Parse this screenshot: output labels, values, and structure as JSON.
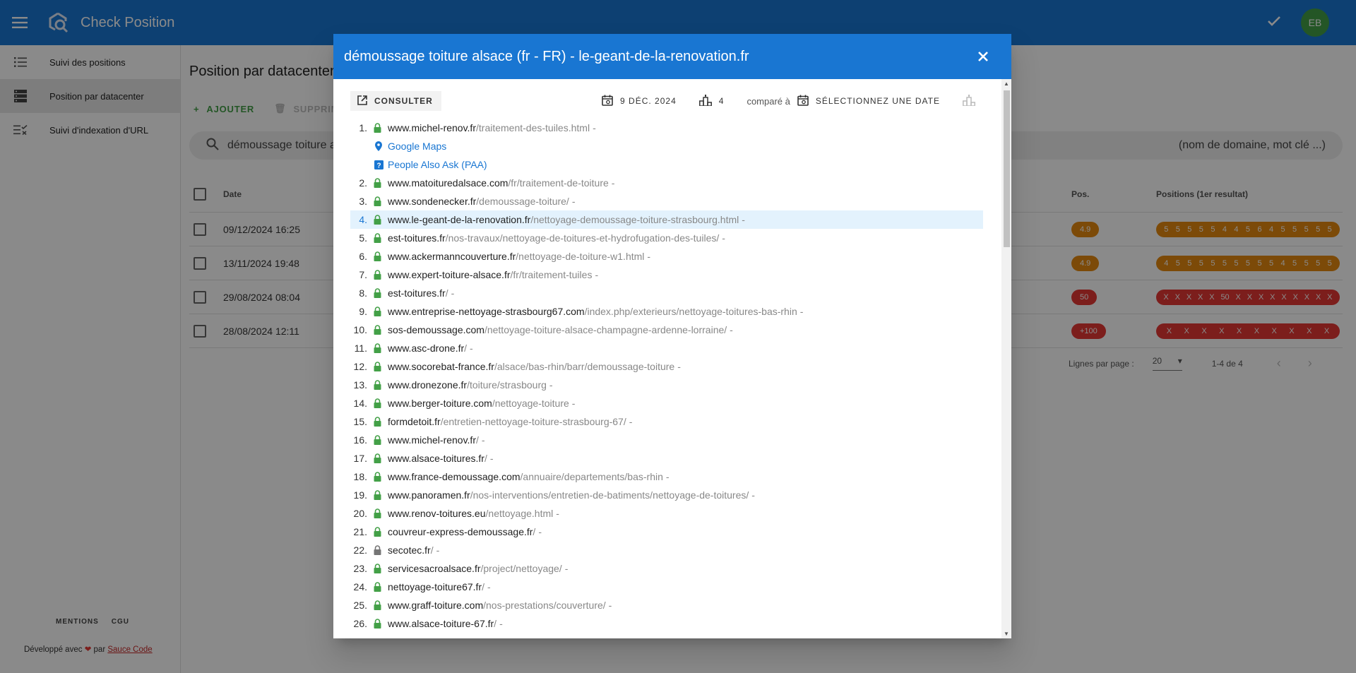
{
  "app": {
    "title": "Check Position",
    "avatar_initials": "EB"
  },
  "sidebar": {
    "items": [
      {
        "label": "Suivi des positions"
      },
      {
        "label": "Position par datacenter"
      },
      {
        "label": "Suivi d'indexation d'URL"
      }
    ],
    "footer_links": [
      "MENTIONS",
      "CGU"
    ],
    "dev_prefix": "Développé avec",
    "dev_mid": "par",
    "dev_link": "Sauce Code"
  },
  "main": {
    "title": "Position par datacenter",
    "add_label": "AJOUTER",
    "delete_label": "SUPPRIMER",
    "search_value": "démoussage toiture alsace",
    "search_placeholder": "(nom de domaine, mot clé ...)",
    "columns": {
      "date": "Date",
      "pos": "Pos.",
      "positions": "Positions (1er resultat)"
    },
    "rows": [
      {
        "date": "09/12/2024 16:25",
        "pos": "4.9",
        "positions": [
          "5",
          "5",
          "5",
          "5",
          "5",
          "4",
          "4",
          "5",
          "6",
          "4",
          "5",
          "5",
          "5",
          "5",
          "5"
        ]
      },
      {
        "date": "13/11/2024 19:48",
        "pos": "4.9",
        "positions": [
          "4",
          "5",
          "5",
          "5",
          "5",
          "5",
          "5",
          "5",
          "5",
          "5",
          "4",
          "5",
          "5",
          "5",
          "5"
        ]
      },
      {
        "date": "29/08/2024 08:04",
        "pos": "50",
        "positions": [
          "X",
          "X",
          "X",
          "X",
          "X",
          "50",
          "X",
          "X",
          "X",
          "X",
          "X",
          "X",
          "X",
          "X",
          "X"
        ]
      },
      {
        "date": "28/08/2024 12:11",
        "pos": "+100",
        "positions": [
          "X",
          "X",
          "X",
          "X",
          "X",
          "X",
          "X",
          "X",
          "X",
          "X"
        ]
      }
    ],
    "pagination": {
      "rows_label": "Lignes par page :",
      "rows_value": "20",
      "range": "1-4 de 4"
    }
  },
  "dialog": {
    "title": "démoussage toiture alsace (fr - FR) - le-geant-de-la-renovation.fr",
    "consult_label": "CONSULTER",
    "date_label": "9 DÉC. 2024",
    "position_value": "4",
    "compare_label": "comparé à",
    "select_date_label": "SÉLECTIONNEZ UNE DATE",
    "features": [
      "Google Maps",
      "People Also Ask (PAA)"
    ],
    "results": [
      {
        "n": "1.",
        "domain": "www.michel-renov.fr",
        "path": "/traitement-des-tuiles.html"
      },
      {
        "n": "2.",
        "domain": "www.matoituredalsace.com",
        "path": "/fr/traitement-de-toiture"
      },
      {
        "n": "3.",
        "domain": "www.sondenecker.fr",
        "path": "/demoussage-toiture/"
      },
      {
        "n": "4.",
        "domain": "www.le-geant-de-la-renovation.fr",
        "path": "/nettoyage-demoussage-toiture-strasbourg.html"
      },
      {
        "n": "5.",
        "domain": "est-toitures.fr",
        "path": "/nos-travaux/nettoyage-de-toitures-et-hydrofugation-des-tuiles/"
      },
      {
        "n": "6.",
        "domain": "www.ackermanncouverture.fr",
        "path": "/nettoyage-de-toiture-w1.html"
      },
      {
        "n": "7.",
        "domain": "www.expert-toiture-alsace.fr",
        "path": "/fr/traitement-tuiles"
      },
      {
        "n": "8.",
        "domain": "est-toitures.fr",
        "path": "/"
      },
      {
        "n": "9.",
        "domain": "www.entreprise-nettoyage-strasbourg67.com",
        "path": "/index.php/exterieurs/nettoyage-toitures-bas-rhin"
      },
      {
        "n": "10.",
        "domain": "sos-demoussage.com",
        "path": "/nettoyage-toiture-alsace-champagne-ardenne-lorraine/"
      },
      {
        "n": "11.",
        "domain": "www.asc-drone.fr",
        "path": "/"
      },
      {
        "n": "12.",
        "domain": "www.socorebat-france.fr",
        "path": "/alsace/bas-rhin/barr/demoussage-toiture"
      },
      {
        "n": "13.",
        "domain": "www.dronezone.fr",
        "path": "/toiture/strasbourg"
      },
      {
        "n": "14.",
        "domain": "www.berger-toiture.com",
        "path": "/nettoyage-toiture"
      },
      {
        "n": "15.",
        "domain": "formdetoit.fr",
        "path": "/entretien-nettoyage-toiture-strasbourg-67/"
      },
      {
        "n": "16.",
        "domain": "www.michel-renov.fr",
        "path": "/"
      },
      {
        "n": "17.",
        "domain": "www.alsace-toitures.fr",
        "path": "/"
      },
      {
        "n": "18.",
        "domain": "www.france-demoussage.com",
        "path": "/annuaire/departements/bas-rhin"
      },
      {
        "n": "19.",
        "domain": "www.panoramen.fr",
        "path": "/nos-interventions/entretien-de-batiments/nettoyage-de-toitures/"
      },
      {
        "n": "20.",
        "domain": "www.renov-toitures.eu",
        "path": "/nettoyage.html"
      },
      {
        "n": "21.",
        "domain": "couvreur-express-demoussage.fr",
        "path": "/"
      },
      {
        "n": "22.",
        "domain": "secotec.fr",
        "path": "/"
      },
      {
        "n": "23.",
        "domain": "servicesacroalsace.fr",
        "path": "/project/nettoyage/"
      },
      {
        "n": "24.",
        "domain": "nettoyage-toiture67.fr",
        "path": "/"
      },
      {
        "n": "25.",
        "domain": "www.graff-toiture.com",
        "path": "/nos-prestations/couverture/"
      },
      {
        "n": "26.",
        "domain": "www.alsace-toiture-67.fr",
        "path": "/"
      }
    ]
  },
  "colors": {
    "primary": "#1976d2",
    "success": "#43a047",
    "orange": "#e6890f",
    "red": "#e53935"
  }
}
